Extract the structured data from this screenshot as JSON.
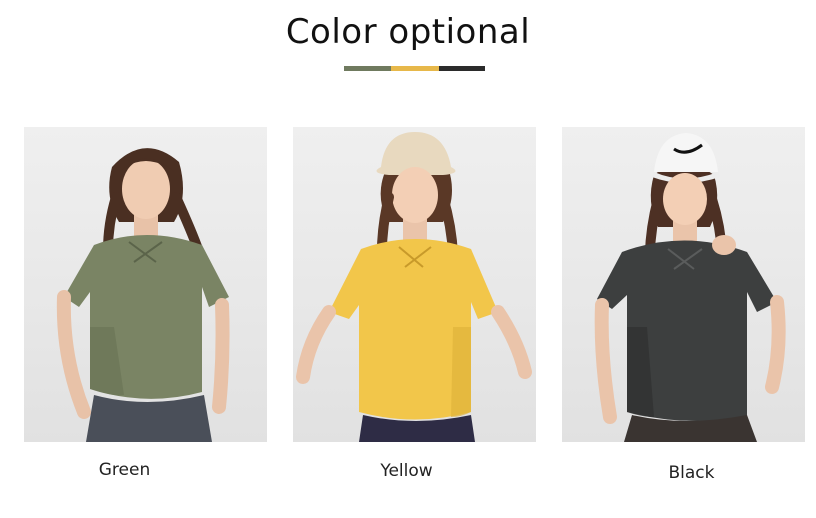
{
  "title": "Color optional",
  "color_bar": [
    "#6f7a5f",
    "#e7b84a",
    "#2b2b2b"
  ],
  "products": [
    {
      "label": "Green",
      "shirt_color": "#7a8464",
      "shirt_shade": "#687254",
      "pants_color": "#4a4f59",
      "hat": "none"
    },
    {
      "label": "Yellow",
      "shirt_color": "#f2c64a",
      "shirt_shade": "#e0b43a",
      "pants_color": "#2e2c45",
      "hat": "bucket-hat"
    },
    {
      "label": "Black",
      "shirt_color": "#3d3f3f",
      "shirt_shade": "#2f3131",
      "pants_color": "#3a3431",
      "hat": "cap"
    }
  ]
}
